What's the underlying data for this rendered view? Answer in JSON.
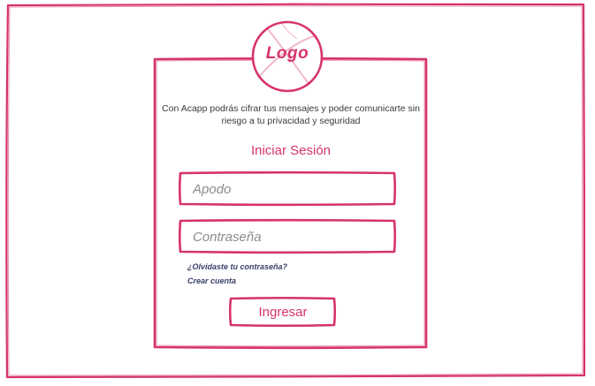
{
  "logo": {
    "text": "Logo"
  },
  "intro": {
    "description": "Con Acapp podrás cifrar tus mensajes y poder comunicarte sin riesgo a tu privacidad y seguridad"
  },
  "login": {
    "title": "Iniciar Sesión",
    "nickname_placeholder": "Apodo",
    "password_placeholder": "Contraseña",
    "forgot_password_link": "¿Olvidaste tu contraseña?",
    "create_account_link": "Crear cuenta",
    "submit_label": "Ingresar"
  },
  "colors": {
    "accent": "#d6336c",
    "link": "#3b3f6b",
    "text": "#3a3a3a",
    "placeholder": "#8c8c8c",
    "background": "#ffffff"
  }
}
